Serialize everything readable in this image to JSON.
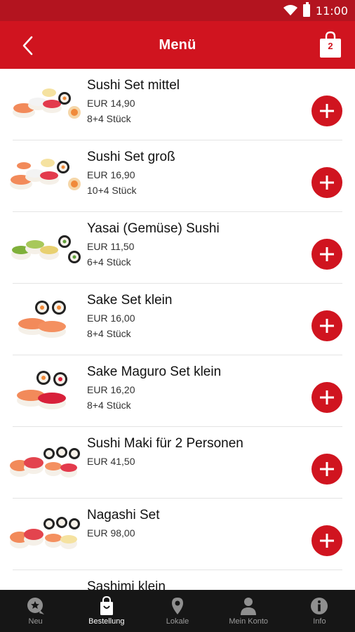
{
  "status_bar": {
    "time": "11:00"
  },
  "header": {
    "title": "Menü",
    "cart_count": "2"
  },
  "menu_items": [
    {
      "name": "Sushi Set mittel",
      "price": "EUR 14,90",
      "pieces": "8+4 Stück",
      "image": "sushi-mix"
    },
    {
      "name": "Sushi Set groß",
      "price": "EUR 16,90",
      "pieces": "10+4 Stück",
      "image": "sushi-mix"
    },
    {
      "name": "Yasai (Gemüse) Sushi",
      "price": "EUR 11,50",
      "pieces": "6+4 Stück",
      "image": "veggie"
    },
    {
      "name": "Sake Set klein",
      "price": "EUR 16,00",
      "pieces": "8+4 Stück",
      "image": "salmon"
    },
    {
      "name": "Sake Maguro Set klein",
      "price": "EUR 16,20",
      "pieces": "8+4 Stück",
      "image": "salmon-tuna"
    },
    {
      "name": "Sushi Maki für 2 Personen",
      "price": "EUR 41,50",
      "pieces": "",
      "image": "sushi-mix"
    },
    {
      "name": "Nagashi Set",
      "price": "EUR 98,00",
      "pieces": "",
      "image": "sushi-mix"
    },
    {
      "name": "Sashimi klein",
      "price": "",
      "pieces": "",
      "image": "sashimi"
    }
  ],
  "bottom_nav": [
    {
      "label": "Neu",
      "icon": "star-chat-icon",
      "active": false
    },
    {
      "label": "Bestellung",
      "icon": "bag-icon",
      "active": true
    },
    {
      "label": "Lokale",
      "icon": "location-pin-icon",
      "active": false
    },
    {
      "label": "Mein Konto",
      "icon": "person-icon",
      "active": false
    },
    {
      "label": "Info",
      "icon": "info-icon",
      "active": false
    }
  ],
  "colors": {
    "brand_red": "#d0141f",
    "status_red": "#b3141f",
    "nav_bg": "#161616"
  }
}
